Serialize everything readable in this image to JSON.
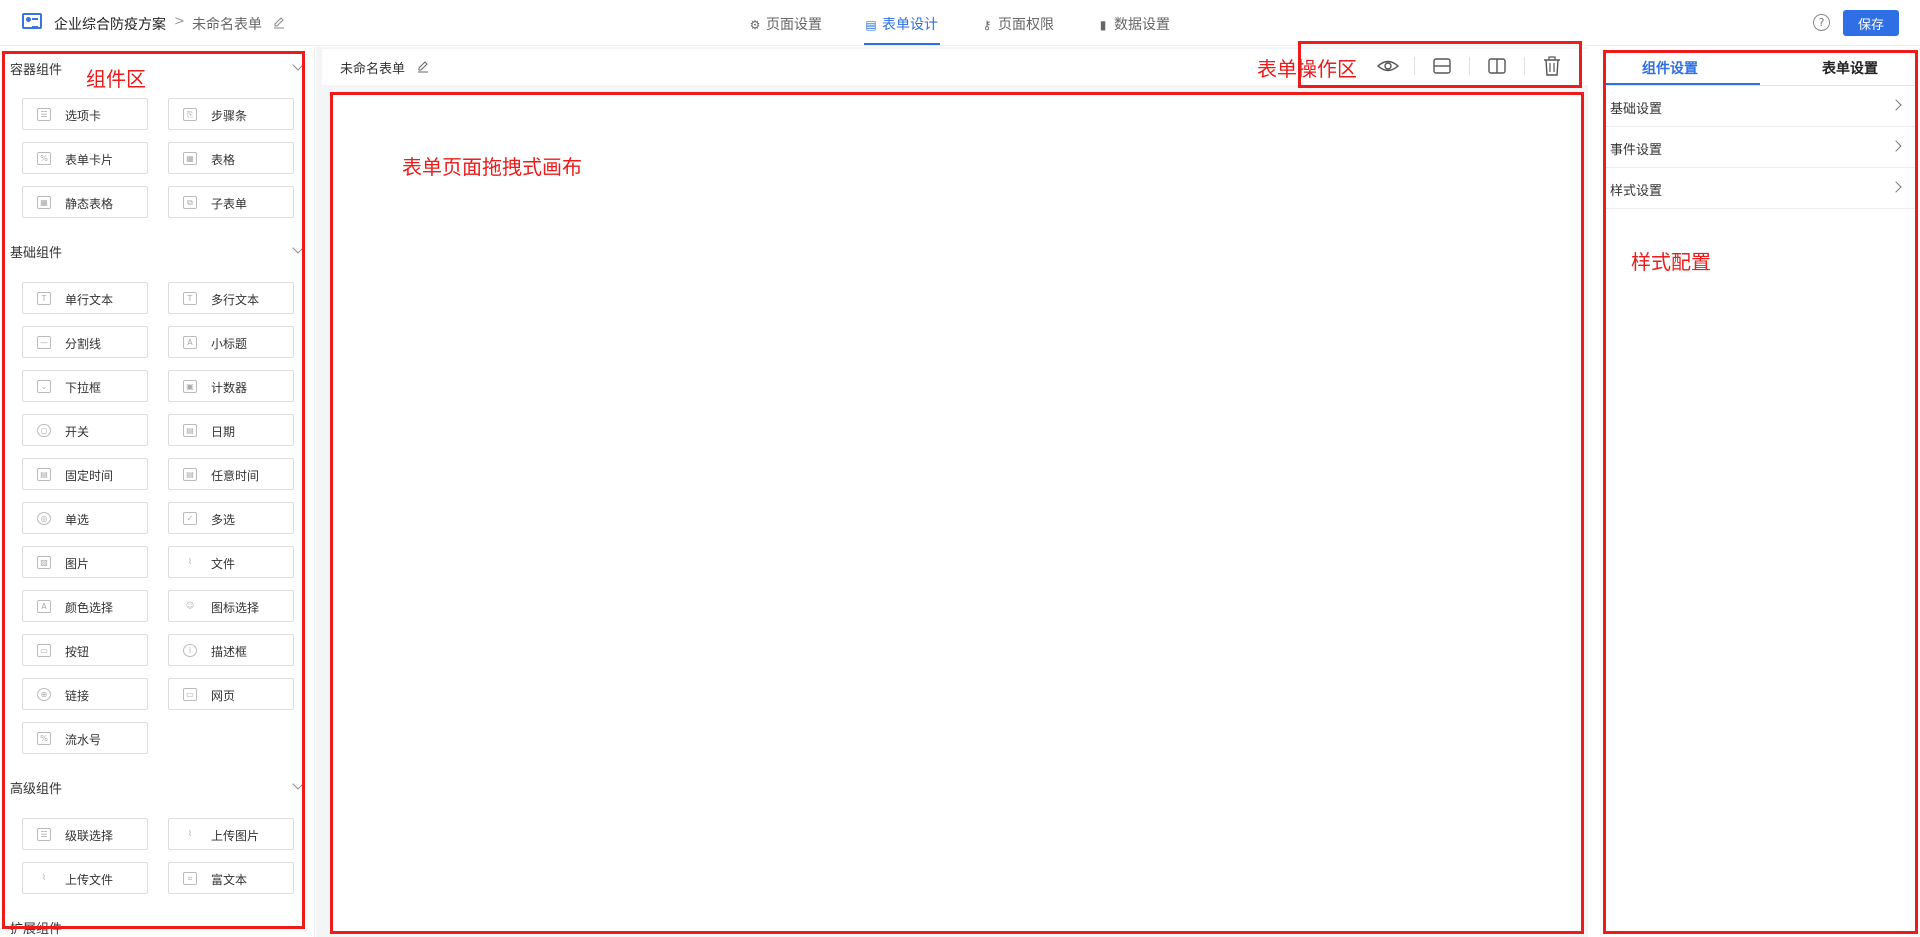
{
  "header": {
    "app_name": "企业综合防疫方案",
    "crumb_sep": ">",
    "form_name": "未命名表单",
    "tabs": [
      {
        "label": "页面设置",
        "icon": "gear-icon"
      },
      {
        "label": "表单设计",
        "icon": "document-icon"
      },
      {
        "label": "页面权限",
        "icon": "key-icon"
      },
      {
        "label": "数据设置",
        "icon": "bar-chart-icon"
      }
    ],
    "active_tab": "表单设计",
    "help_glyph": "?",
    "save_label": "保存"
  },
  "components": {
    "container": {
      "title": "容器组件",
      "items": [
        {
          "label": "选项卡",
          "icon": "tabs-icon"
        },
        {
          "label": "步骤条",
          "icon": "steps-icon"
        },
        {
          "label": "表单卡片",
          "icon": "form-card-icon"
        },
        {
          "label": "表格",
          "icon": "table-icon"
        },
        {
          "label": "静态表格",
          "icon": "static-table-icon"
        },
        {
          "label": "子表单",
          "icon": "subform-icon"
        }
      ]
    },
    "basic": {
      "title": "基础组件",
      "items": [
        {
          "label": "单行文本",
          "icon": "text-icon"
        },
        {
          "label": "多行文本",
          "icon": "textarea-icon"
        },
        {
          "label": "分割线",
          "icon": "divider-icon"
        },
        {
          "label": "小标题",
          "icon": "subtitle-icon"
        },
        {
          "label": "下拉框",
          "icon": "dropdown-icon"
        },
        {
          "label": "计数器",
          "icon": "counter-icon"
        },
        {
          "label": "开关",
          "icon": "switch-icon"
        },
        {
          "label": "日期",
          "icon": "calendar-icon"
        },
        {
          "label": "固定时间",
          "icon": "calendar-icon"
        },
        {
          "label": "任意时间",
          "icon": "calendar-icon"
        },
        {
          "label": "单选",
          "icon": "radio-icon"
        },
        {
          "label": "多选",
          "icon": "checkbox-icon"
        },
        {
          "label": "图片",
          "icon": "image-icon"
        },
        {
          "label": "文件",
          "icon": "paperclip-icon"
        },
        {
          "label": "颜色选择",
          "icon": "color-picker-icon"
        },
        {
          "label": "图标选择",
          "icon": "user-icon"
        },
        {
          "label": "按钮",
          "icon": "button-icon"
        },
        {
          "label": "描述框",
          "icon": "info-icon"
        },
        {
          "label": "链接",
          "icon": "globe-icon"
        },
        {
          "label": "网页",
          "icon": "webpage-icon"
        },
        {
          "label": "流水号",
          "icon": "serial-number-icon"
        }
      ]
    },
    "advanced": {
      "title": "高级组件",
      "items": [
        {
          "label": "级联选择",
          "icon": "cascade-icon"
        },
        {
          "label": "上传图片",
          "icon": "paperclip-icon"
        },
        {
          "label": "上传文件",
          "icon": "paperclip-icon"
        },
        {
          "label": "富文本",
          "icon": "rich-text-icon"
        }
      ]
    },
    "extension": {
      "title": "扩展组件"
    }
  },
  "canvas": {
    "form_title": "未命名表单",
    "tools": [
      "eye-icon",
      "single-column-icon",
      "two-column-icon",
      "trash-icon"
    ]
  },
  "right_panel": {
    "tabs": [
      "组件设置",
      "表单设置"
    ],
    "active_tab": "组件设置",
    "rows": [
      "基础设置",
      "事件设置",
      "样式设置"
    ]
  },
  "annotations": {
    "component_area": "组件区",
    "form_ops_area": "表单操作区",
    "canvas_area": "表单页面拖拽式画布",
    "style_config": "样式配置"
  },
  "colors": {
    "primary": "#2f6fe5",
    "annotation": "#ee1b1b"
  }
}
